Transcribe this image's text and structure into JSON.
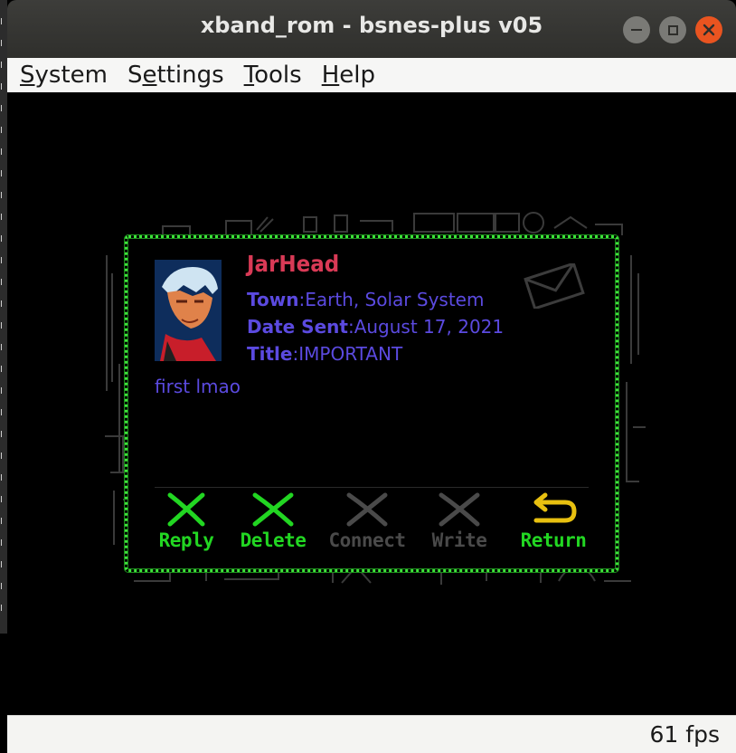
{
  "window": {
    "title": "xband_rom - bsnes-plus v05",
    "controls": {
      "minimize_icon": "minimize-icon",
      "maximize_icon": "maximize-icon",
      "close_icon": "close-icon",
      "close_color": "#e95420"
    }
  },
  "menu": {
    "items": [
      {
        "label": "System",
        "mnemonic": "S"
      },
      {
        "label": "Settings",
        "mnemonic": "e"
      },
      {
        "label": "Tools",
        "mnemonic": "T"
      },
      {
        "label": "Help",
        "mnemonic": "H"
      }
    ]
  },
  "message": {
    "sender": "JarHead",
    "town_label": "Town",
    "town_value": "Earth, Solar System",
    "date_label": "Date Sent",
    "date_value": "August 17, 2021",
    "title_label": "Title",
    "title_value": "IMPORTANT",
    "body": "first lmao",
    "colors": {
      "frame": "#3ee43a",
      "sender": "#d93a56",
      "text": "#5b4ae0"
    }
  },
  "actions": [
    {
      "label": "Reply",
      "enabled": true,
      "icon": "x-icon"
    },
    {
      "label": "Delete",
      "enabled": true,
      "icon": "x-icon"
    },
    {
      "label": "Connect",
      "enabled": false,
      "icon": "x-icon"
    },
    {
      "label": "Write",
      "enabled": false,
      "icon": "x-icon"
    },
    {
      "label": "Return",
      "enabled": true,
      "icon": "return-arrow-icon"
    }
  ],
  "status": {
    "fps": "61 fps"
  }
}
